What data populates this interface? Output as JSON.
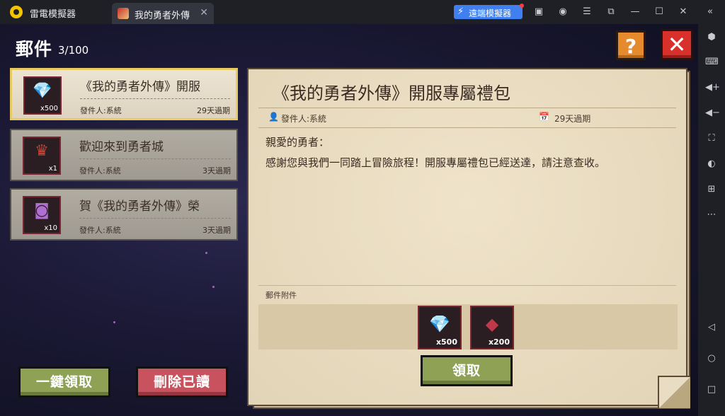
{
  "titlebar": {
    "app_title": "雷電模擬器",
    "tab_label": "我的勇者外傳",
    "tab_close": "✕",
    "remote_button": "遠端模擬器"
  },
  "titlebar_icons": [
    "store-icon",
    "account-icon",
    "menu-icon",
    "popout-icon",
    "minimize-icon",
    "maximize-icon",
    "close-window-icon",
    "collapse-sidebar-icon"
  ],
  "sidebar_icons": [
    "settings-icon",
    "keyboard-icon",
    "volume-up-icon",
    "volume-down-icon",
    "screenshot-icon",
    "install-apk-icon",
    "multi-instance-icon",
    "more-icon",
    "back-icon",
    "home-icon",
    "recents-icon"
  ],
  "mail": {
    "title": "郵件",
    "count": "3/100",
    "help_label": "?",
    "close_label": "✕",
    "items": [
      {
        "subject": "《我的勇者外傳》開服",
        "sender": "發件人:系統",
        "expire": "29天過期",
        "qty": "x500",
        "icon": "diamond-icon",
        "selected": true
      },
      {
        "subject": "歡迎來到勇者城",
        "sender": "發件人:系統",
        "expire": "3天過期",
        "qty": "x1",
        "icon": "helmet-icon",
        "selected": false
      },
      {
        "subject": "賀《我的勇者外傳》榮",
        "sender": "發件人:系統",
        "expire": "3天過期",
        "qty": "x10",
        "icon": "chest-icon",
        "selected": false
      }
    ],
    "claim_all": "一鍵領取",
    "delete_read": "刪除已讀"
  },
  "letter": {
    "title": "《我的勇者外傳》開服專屬禮包",
    "sender": "發件人:系統",
    "expire": "29天過期",
    "greeting": "親愛的勇者：",
    "body": "感謝您與我們一同踏上冒險旅程！開服專屬禮包已經送達，請注意查收。",
    "attachments_label": "郵件附件",
    "attachments": [
      {
        "icon": "diamond-icon",
        "qty": "x500"
      },
      {
        "icon": "crystal-ore-icon",
        "qty": "x200"
      }
    ],
    "claim": "領取"
  },
  "colors": {
    "accent_blue": "#3f7ff0",
    "button_green": "#8ea155",
    "button_red": "#c8525e",
    "close_red": "#d8302a",
    "help_orange": "#e68a2e",
    "selected_border": "#e8c964"
  }
}
